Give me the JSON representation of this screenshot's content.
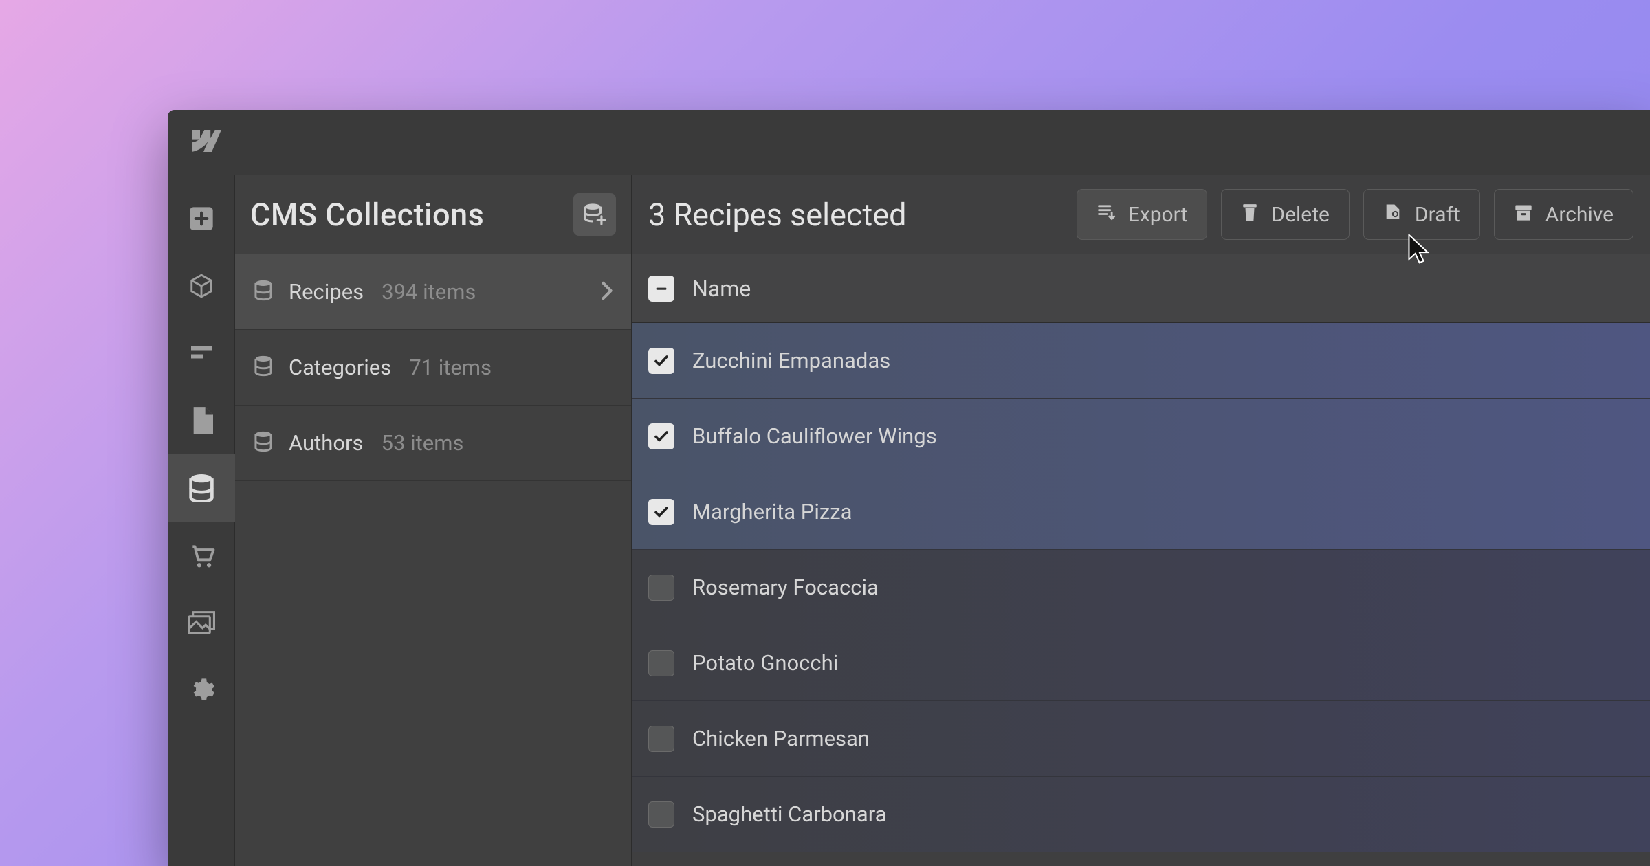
{
  "sidebar": {
    "title": "CMS Collections",
    "collections": [
      {
        "name": "Recipes",
        "count": "394 items",
        "active": true
      },
      {
        "name": "Categories",
        "count": "71 items",
        "active": false
      },
      {
        "name": "Authors",
        "count": "53 items",
        "active": false
      }
    ]
  },
  "toolbar": {
    "title": "3 Recipes selected",
    "export_label": "Export",
    "delete_label": "Delete",
    "draft_label": "Draft",
    "archive_label": "Archive"
  },
  "table": {
    "column_label": "Name",
    "rows": [
      {
        "name": "Zucchini Empanadas",
        "selected": true
      },
      {
        "name": "Buffalo Cauliflower Wings",
        "selected": true
      },
      {
        "name": "Margherita Pizza",
        "selected": true
      },
      {
        "name": "Rosemary Focaccia",
        "selected": false
      },
      {
        "name": "Potato Gnocchi",
        "selected": false
      },
      {
        "name": "Chicken Parmesan",
        "selected": false
      },
      {
        "name": "Spaghetti Carbonara",
        "selected": false
      }
    ]
  }
}
